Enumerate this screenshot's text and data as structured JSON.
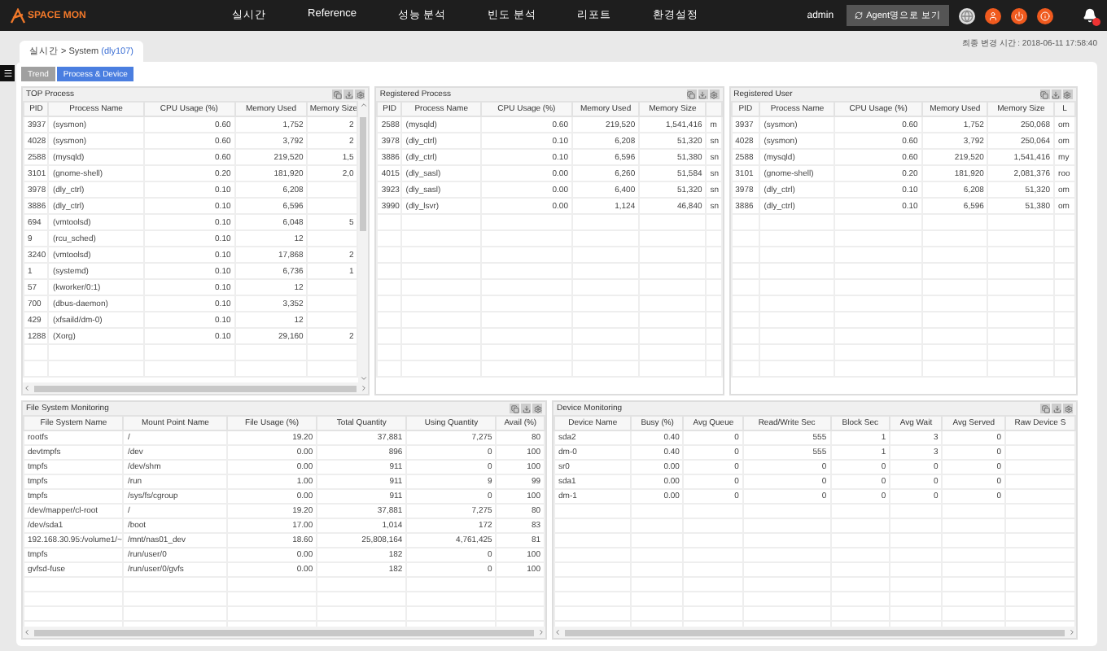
{
  "nav": {
    "logo": "SPACE MON",
    "menu": [
      {
        "label": "실시간"
      },
      {
        "label": "Reference"
      },
      {
        "label": "성능 분석"
      },
      {
        "label": "빈도 분석"
      },
      {
        "label": "리포트"
      },
      {
        "label": "환경설정"
      }
    ],
    "user": "admin",
    "agent_button": "Agent명으로 보기"
  },
  "breadcrumb": {
    "path": "실시간 > System",
    "host": "(dly107)"
  },
  "last_update": "최종 변경 시간 : 2018-06-11 17:58:40",
  "tabs": [
    {
      "label": "Trend",
      "selected": false
    },
    {
      "label": "Process & Device",
      "selected": true
    }
  ],
  "top_panels": [
    {
      "title": "TOP Process",
      "columns": [
        {
          "label": "PID",
          "kind": "text"
        },
        {
          "label": "Process Name",
          "kind": "text"
        },
        {
          "label": "CPU Usage (%)",
          "kind": "number"
        },
        {
          "label": "Memory Used",
          "kind": "number"
        },
        {
          "label": "Memory Size",
          "kind": "number"
        }
      ],
      "rows": [
        [
          "3937",
          "(sysmon)",
          "0.60",
          "1,752",
          "2"
        ],
        [
          "4028",
          "(sysmon)",
          "0.60",
          "3,792",
          "2"
        ],
        [
          "2588",
          "(mysqld)",
          "0.60",
          "219,520",
          "1,5"
        ],
        [
          "3101",
          "(gnome-shell)",
          "0.20",
          "181,920",
          "2,0"
        ],
        [
          "3978",
          "(dly_ctrl)",
          "0.10",
          "6,208"
        ],
        [
          "3886",
          "(dly_ctrl)",
          "0.10",
          "6,596"
        ],
        [
          "694",
          "(vmtoolsd)",
          "0.10",
          "6,048",
          "5"
        ],
        [
          "9",
          "(rcu_sched)",
          "0.10",
          "12"
        ],
        [
          "3240",
          "(vmtoolsd)",
          "0.10",
          "17,868",
          "2"
        ],
        [
          "1",
          "(systemd)",
          "0.10",
          "6,736",
          "1"
        ],
        [
          "57",
          "(kworker/0:1)",
          "0.10",
          "12"
        ],
        [
          "700",
          "(dbus-daemon)",
          "0.10",
          "3,352"
        ],
        [
          "429",
          "(xfsaild/dm-0)",
          "0.10",
          "12"
        ],
        [
          "1288",
          "(Xorg)",
          "0.10",
          "29,160",
          "2"
        ]
      ]
    },
    {
      "title": "Registered Process",
      "columns": [
        {
          "label": "PID",
          "kind": "text"
        },
        {
          "label": "Process Name",
          "kind": "text"
        },
        {
          "label": "CPU Usage (%)",
          "kind": "number"
        },
        {
          "label": "Memory Used",
          "kind": "number"
        },
        {
          "label": "Memory Size",
          "kind": "number"
        },
        {
          "kind": "text"
        }
      ],
      "rows": [
        [
          "2588",
          "(mysqld)",
          "0.60",
          "219,520",
          "1,541,416",
          "m"
        ],
        [
          "3978",
          "(dly_ctrl)",
          "0.10",
          "6,208",
          "51,320",
          "sn"
        ],
        [
          "3886",
          "(dly_ctrl)",
          "0.10",
          "6,596",
          "51,380",
          "sn"
        ],
        [
          "4015",
          "(dly_sasl)",
          "0.00",
          "6,260",
          "51,584",
          "sn"
        ],
        [
          "3923",
          "(dly_sasl)",
          "0.00",
          "6,400",
          "51,320",
          "sn"
        ],
        [
          "3990",
          "(dly_lsvr)",
          "0.00",
          "1,124",
          "46,840",
          "sn"
        ]
      ]
    },
    {
      "title": "Registered User",
      "columns": [
        {
          "label": "PID",
          "kind": "text"
        },
        {
          "label": "Process Name",
          "kind": "text"
        },
        {
          "label": "CPU Usage (%)",
          "kind": "number"
        },
        {
          "label": "Memory Used",
          "kind": "number"
        },
        {
          "label": "Memory Size",
          "kind": "number"
        },
        {
          "label": "L",
          "kind": "text"
        }
      ],
      "rows": [
        [
          "3937",
          "(sysmon)",
          "0.60",
          "1,752",
          "250,068",
          "om"
        ],
        [
          "4028",
          "(sysmon)",
          "0.60",
          "3,792",
          "250,064",
          "om"
        ],
        [
          "2588",
          "(mysqld)",
          "0.60",
          "219,520",
          "1,541,416",
          "my"
        ],
        [
          "3101",
          "(gnome-shell)",
          "0.20",
          "181,920",
          "2,081,376",
          "roo"
        ],
        [
          "3978",
          "(dly_ctrl)",
          "0.10",
          "6,208",
          "51,320",
          "om"
        ],
        [
          "3886",
          "(dly_ctrl)",
          "0.10",
          "6,596",
          "51,380",
          "om"
        ]
      ]
    }
  ],
  "bottom_panels": [
    {
      "title": "File System Monitoring",
      "columns": [
        {
          "label": "File System Name",
          "kind": "text"
        },
        {
          "label": "Mount Point Name",
          "kind": "text"
        },
        {
          "label": "File Usage (%)",
          "kind": "number"
        },
        {
          "label": "Total Quantity",
          "kind": "number"
        },
        {
          "label": "Using Quantity",
          "kind": "number"
        },
        {
          "label": "Avail (%)",
          "kind": "number"
        }
      ],
      "rows": [
        [
          "rootfs",
          "/",
          "19.20",
          "37,881",
          "7,275",
          "80"
        ],
        [
          "devtmpfs",
          "/dev",
          "0.00",
          "896",
          "0",
          "100"
        ],
        [
          "tmpfs",
          "/dev/shm",
          "0.00",
          "911",
          "0",
          "100"
        ],
        [
          "tmpfs",
          "/run",
          "1.00",
          "911",
          "9",
          "99"
        ],
        [
          "tmpfs",
          "/sys/fs/cgroup",
          "0.00",
          "911",
          "0",
          "100"
        ],
        [
          "/dev/mapper/cl-root",
          "/",
          "19.20",
          "37,881",
          "7,275",
          "80"
        ],
        [
          "/dev/sda1",
          "/boot",
          "17.00",
          "1,014",
          "172",
          "83"
        ],
        [
          "192.168.30.95:/volume1/~",
          "/mnt/nas01_dev",
          "18.60",
          "25,808,164",
          "4,761,425",
          "81"
        ],
        [
          "tmpfs",
          "/run/user/0",
          "0.00",
          "182",
          "0",
          "100"
        ],
        [
          "gvfsd-fuse",
          "/run/user/0/gvfs",
          "0.00",
          "182",
          "0",
          "100"
        ]
      ]
    },
    {
      "title": "Device Monitoring",
      "columns": [
        {
          "label": "Device Name",
          "kind": "text"
        },
        {
          "label": "Busy (%)",
          "kind": "number"
        },
        {
          "label": "Avg Queue",
          "kind": "number"
        },
        {
          "label": "Read/Write Sec",
          "kind": "number"
        },
        {
          "label": "Block Sec",
          "kind": "number"
        },
        {
          "label": "Avg Wait",
          "kind": "number"
        },
        {
          "label": "Avg Served",
          "kind": "number"
        },
        {
          "label": "Raw Device S"
        }
      ],
      "rows": [
        [
          "sda2",
          "0.40",
          "0",
          "555",
          "1",
          "3",
          "0"
        ],
        [
          "dm-0",
          "0.40",
          "0",
          "555",
          "1",
          "3",
          "0"
        ],
        [
          "sr0",
          "0.00",
          "0",
          "0",
          "0",
          "0",
          "0"
        ],
        [
          "sda1",
          "0.00",
          "0",
          "0",
          "0",
          "0",
          "0"
        ],
        [
          "dm-1",
          "0.00",
          "0",
          "0",
          "0",
          "0",
          "0"
        ]
      ]
    }
  ]
}
